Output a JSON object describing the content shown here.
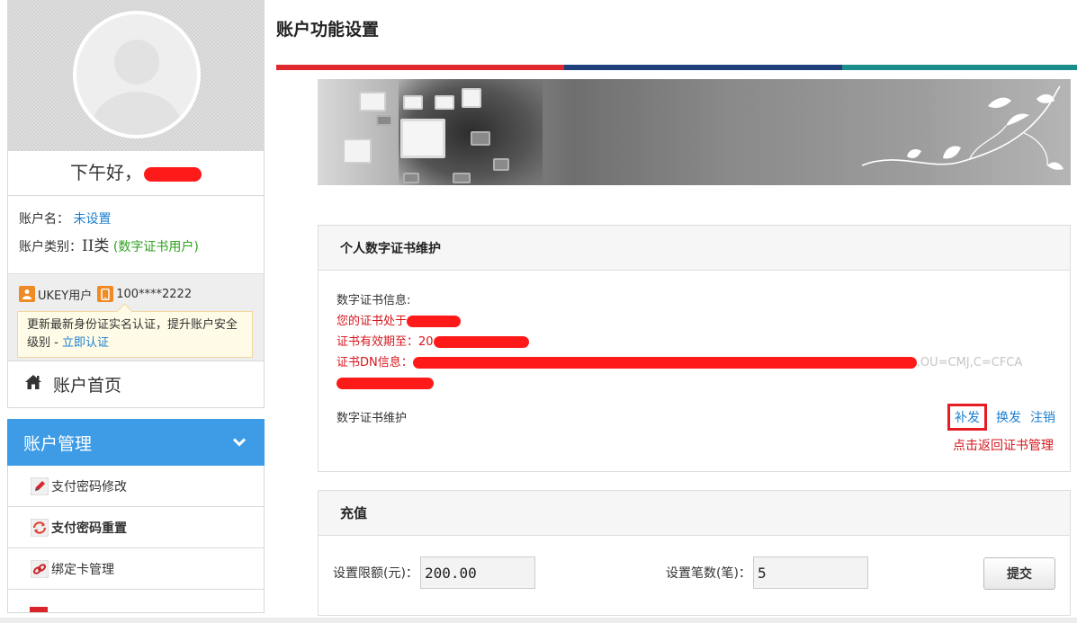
{
  "sidebar": {
    "greeting": "下午好，",
    "account_name_label": "账户名：",
    "account_name_value": "未设置",
    "account_type_label": "账户类别：",
    "account_type_value": "II类",
    "account_type_note": "(数字证书用户)",
    "ukey_user": "UKEY用户",
    "phone": "100****2222",
    "tip_text": "更新最新身份证实名认证，提升账户安全级别 - ",
    "tip_link": "立即认证",
    "home_label": "账户首页",
    "menu_title": "账户管理",
    "menu_items": [
      {
        "label": "支付密码修改"
      },
      {
        "label": "支付密码重置"
      },
      {
        "label": "绑定卡管理"
      }
    ]
  },
  "main": {
    "title": "账户功能设置",
    "cert_panel": {
      "title": "个人数字证书维护",
      "info_label": "数字证书信息:",
      "status_prefix": "您的证书处于",
      "valid_prefix": "证书有效期至：20",
      "dn_prefix": "证书DN信息：",
      "dn_tail": ",OU=CMJ,C=CFCA",
      "maintenance_label": "数字证书维护",
      "actions": {
        "reissue": "补发",
        "renew": "换发",
        "revoke": "注销"
      },
      "back_link": "点击返回证书管理"
    },
    "recharge_panel": {
      "title": "充值",
      "limit_label": "设置限额(元)：",
      "limit_value": "200.00",
      "count_label": "设置笔数(笔)：",
      "count_value": "5",
      "submit_label": "提交"
    }
  },
  "colors": {
    "accent_blue": "#3e9ce6",
    "link_blue": "#1b7fcf",
    "alert_red": "#d6161c",
    "stripe_red": "#e0292e",
    "stripe_navy": "#1e3f7a",
    "stripe_teal": "#1b8d8a"
  }
}
